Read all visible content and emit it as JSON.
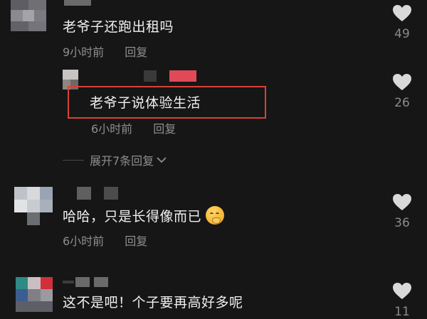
{
  "comments": [
    {
      "text": "老爷子还跑出租吗",
      "time": "9小时前",
      "reply": "回复",
      "likes": "49"
    },
    {
      "text": "老爷子说体验生活",
      "time": "6小时前",
      "reply": "回复",
      "likes": "26"
    },
    {
      "text": "哈哈，只是长得像而已",
      "time": "6小时前",
      "reply": "回复",
      "likes": "36"
    },
    {
      "text": "这不是吧！个子要再高好多呢",
      "likes": "11"
    }
  ],
  "expand_replies": "展开7条回复",
  "icons": {
    "like": "heart-icon",
    "chevron": "chevron-down-icon",
    "emoji": "smirk-emoji"
  },
  "colors": {
    "background": "#161616",
    "highlight_border": "#d8423a",
    "meta_text": "#8e8e8e",
    "heart": "#d9d9d9"
  }
}
